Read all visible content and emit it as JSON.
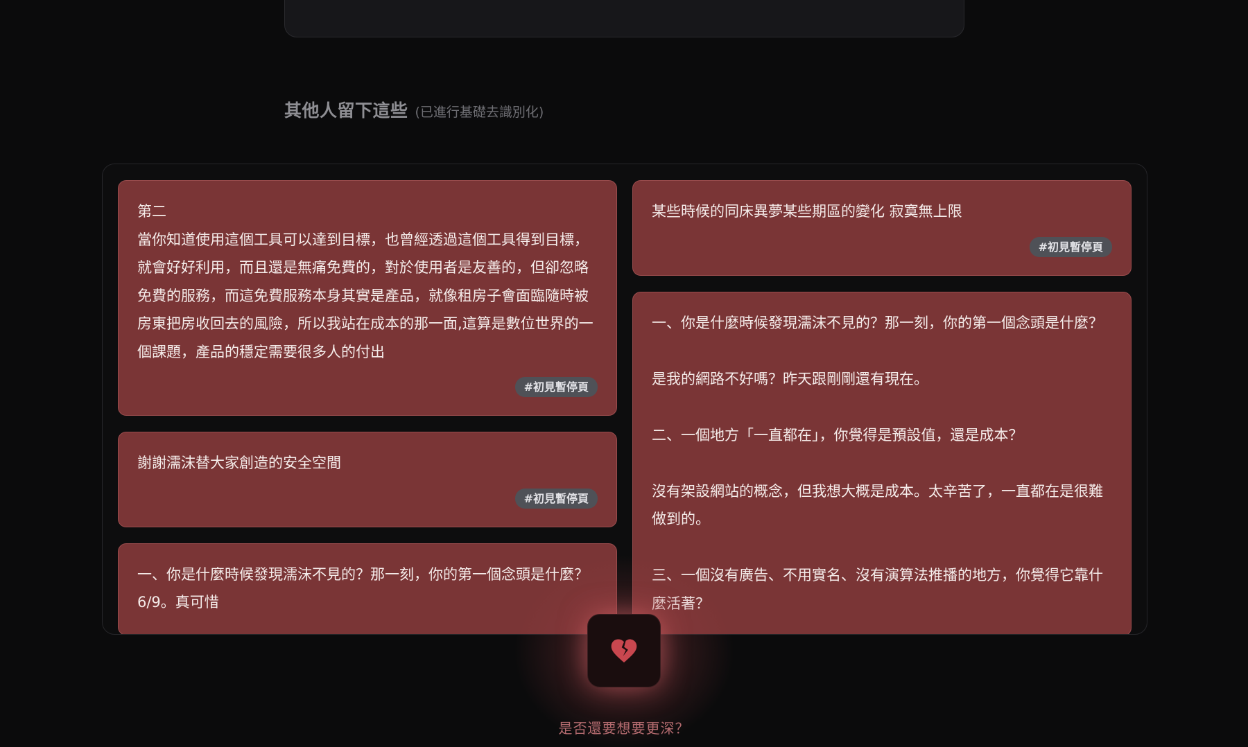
{
  "section": {
    "title": "其他人留下這些",
    "note": "(已進行基礎去識別化)"
  },
  "cards_left": [
    {
      "text": "第二\n當你知道使用這個工具可以達到目標，也曾經透過這個工具得到目標，就會好好利用，而且還是無痛免費的，對於使用者是友善的，但卻忽略免費的服務，而這免費服務本身其實是產品，就像租房子會面臨隨時被房東把房收回去的風險，所以我站在成本的那一面,這算是數位世界的一個課題，產品的穩定需要很多人的付出",
      "tag": "#初見暫停頁"
    },
    {
      "text": "謝謝濡沫替大家創造的安全空間",
      "tag": "#初見暫停頁"
    },
    {
      "text": "一、你是什麼時候發現濡沫不見的？那一刻，你的第一個念頭是什麼？\n6/9。真可惜",
      "tag": ""
    }
  ],
  "cards_right": [
    {
      "text": "某些時候的同床異夢某些期區的變化 寂寞無上限",
      "tag": "#初見暫停頁"
    },
    {
      "text": "一、你是什麼時候發現濡沫不見的？那一刻，你的第一個念頭是什麼？\n\n是我的網路不好嗎？昨天跟剛剛還有現在。\n\n二、一個地方「一直都在」，你覺得是預設值，還是成本？\n\n沒有架設網站的概念，但我想大概是成本。太辛苦了，一直都在是很難做到的。\n\n三、一個沒有廣告、不用實名、沒有演算法推播的地方，你覺得它靠什麼活著？",
      "tag": ""
    }
  ],
  "bottom": {
    "icon": "broken-heart-icon",
    "prompt": "是否還要想要更深？"
  },
  "colors": {
    "card_bg": "#7a3536",
    "tag_bg": "#4f5157",
    "prompt": "#b26a6e"
  }
}
